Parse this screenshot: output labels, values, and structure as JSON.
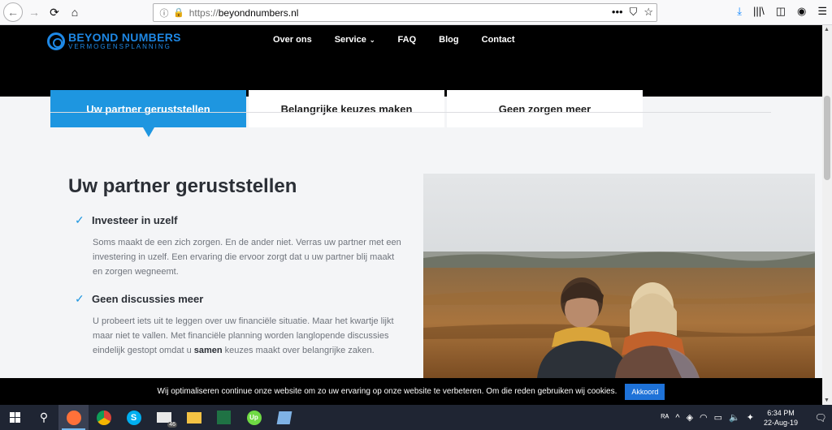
{
  "browser": {
    "url_scheme": "https://",
    "url_host": "beyondnumbers.nl",
    "back": "←",
    "forward": "→",
    "reload": "⟳",
    "home": "⌂",
    "info": "ⓘ",
    "lock": "🔒",
    "page_actions": "•••",
    "pocket": "⛉",
    "bookmark": "☆",
    "download": "⤓",
    "library": "|||\\",
    "sidebar": "◫",
    "account": "◉",
    "menu": "☰"
  },
  "site": {
    "logo_title": "BEYOND NUMBERS",
    "logo_subtitle": "VERMOGENSPLANNING",
    "nav": [
      {
        "label": "Over ons"
      },
      {
        "label": "Service",
        "caret": "⌄"
      },
      {
        "label": "FAQ"
      },
      {
        "label": "Blog"
      },
      {
        "label": "Contact"
      }
    ]
  },
  "tabs": [
    {
      "label": "Uw partner geruststellen",
      "active": true
    },
    {
      "label": "Belangrijke keuzes maken",
      "active": false
    },
    {
      "label": "Geen zorgen meer",
      "active": false
    }
  ],
  "content": {
    "title": "Uw partner geruststellen",
    "check": "✓",
    "features": [
      {
        "title": "Investeer in uzelf",
        "body": "Soms maakt de een zich zorgen. En de ander niet. Verras uw partner met een investering in uzelf. Een ervaring die ervoor zorgt dat u uw partner blij maakt en zorgen wegneemt."
      },
      {
        "title": "Geen discussies meer",
        "body_before": "U probeert iets uit te leggen over uw financiële situatie. Maar het kwartje lijkt maar niet te vallen. Met financiële planning worden langlopende discussies eindelijk gestopt omdat u ",
        "body_bold": "samen",
        "body_after": " keuzes maakt over belangrijke zaken."
      }
    ]
  },
  "cookie": {
    "text": "Wij optimaliseren continue onze website om zo uw ervaring op onze website te verbeteren. Om die reden gebruiken wij cookies.",
    "button": "Akkoord"
  },
  "taskbar": {
    "search": "⚲",
    "apps": [
      {
        "name": "firefox",
        "color": "#ff7139",
        "active": true
      },
      {
        "name": "chrome",
        "color": "#4caf50"
      },
      {
        "name": "skype",
        "color": "#00aff0",
        "letter": "S"
      },
      {
        "name": "mail",
        "color": "#e8e8e8",
        "badge": "46"
      },
      {
        "name": "explorer",
        "color": "#f3c244"
      },
      {
        "name": "excel",
        "color": "#1f7244"
      },
      {
        "name": "upwork",
        "color": "#6fda44",
        "letter": "Up"
      },
      {
        "name": "notes",
        "color": "#7fb2e5"
      }
    ],
    "clock_time": "6:34 PM",
    "clock_date": "22-Aug-19",
    "tray_icons": [
      "ᴿᴬ",
      "^",
      "◈",
      "◠",
      "▭",
      "🔈",
      "✦"
    ],
    "notification": "🗨"
  },
  "colors": {
    "accent": "#1e96e0",
    "header_bg": "#000000",
    "page_bg": "#f4f5f7"
  }
}
